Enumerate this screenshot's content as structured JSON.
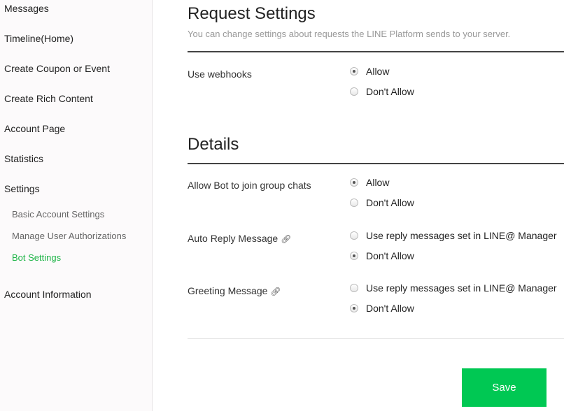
{
  "sidebar": {
    "items": [
      "Messages",
      "Timeline(Home)",
      "Create Coupon or Event",
      "Create Rich Content",
      "Account Page",
      "Statistics",
      "Settings"
    ],
    "sub_items": [
      "Basic Account Settings",
      "Manage User Authorizations",
      "Bot Settings"
    ],
    "active": "Bot Settings",
    "last_item": "Account Information",
    "active_color": "#1db446"
  },
  "request": {
    "title": "Request Settings",
    "description": "You can change settings about requests the LINE Platform sends to your server.",
    "webhooks": {
      "label": "Use webhooks",
      "options": [
        "Allow",
        "Don't Allow"
      ],
      "selected": "Allow"
    }
  },
  "details": {
    "title": "Details",
    "join": {
      "label": "Allow Bot to join group chats",
      "options": [
        "Allow",
        "Don't Allow"
      ],
      "selected": "Allow"
    },
    "auto_reply": {
      "label": "Auto Reply Message",
      "icon": "link-icon",
      "options": [
        "Use reply messages set in LINE@ Manager",
        "Don't Allow"
      ],
      "selected": "Don't Allow"
    },
    "greeting": {
      "label": "Greeting Message",
      "icon": "link-icon",
      "options": [
        "Use reply messages set in LINE@ Manager",
        "Don't Allow"
      ],
      "selected": "Don't Allow"
    }
  },
  "save_label": "Save",
  "accent": "#00c853"
}
